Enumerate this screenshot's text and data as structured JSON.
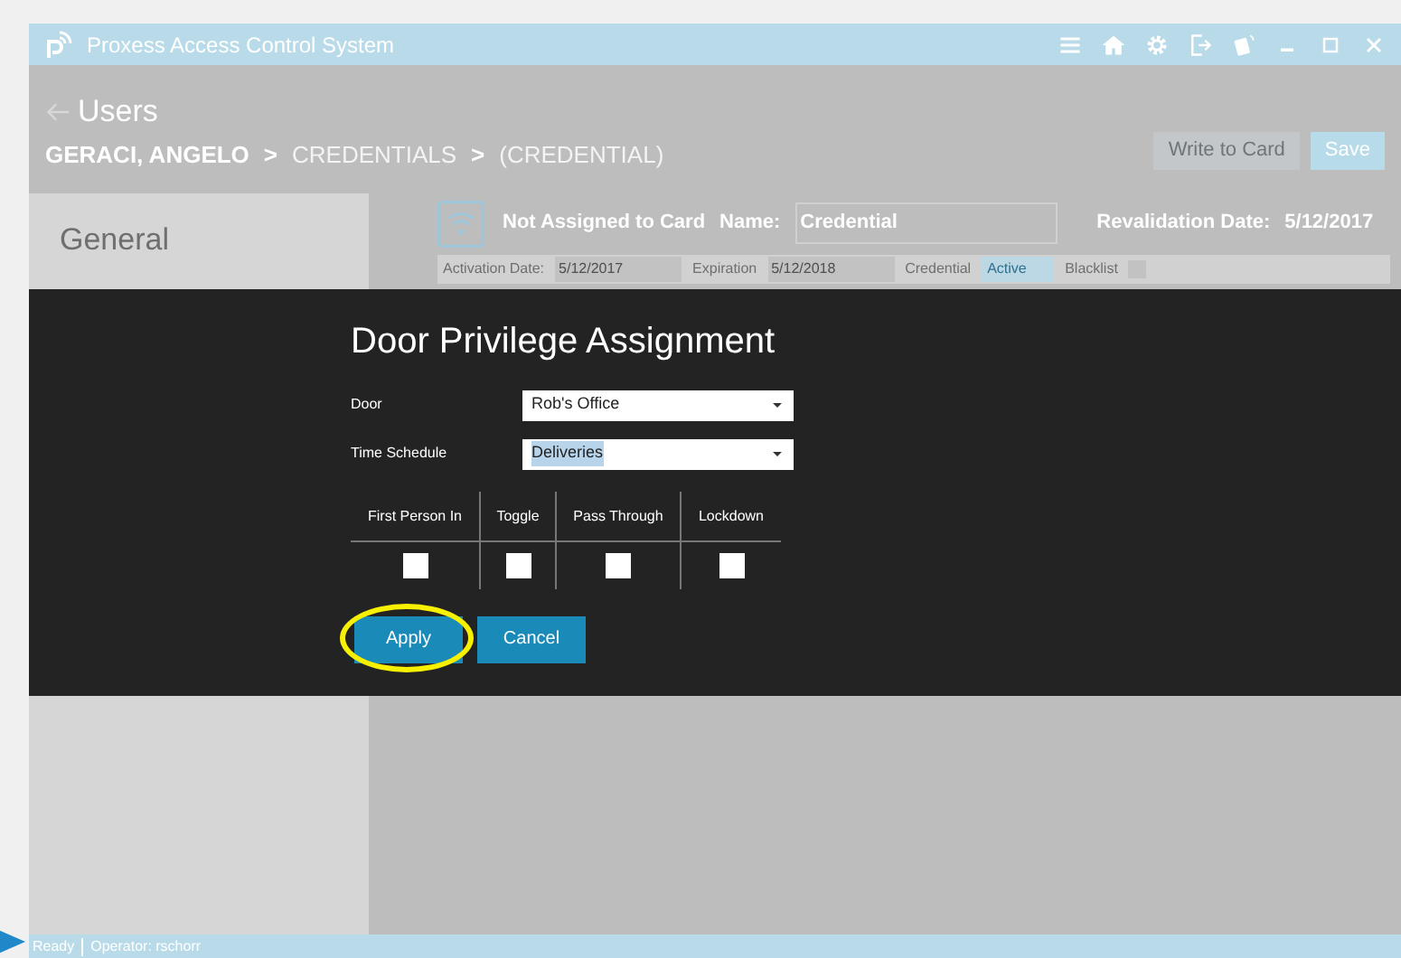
{
  "window": {
    "title": "Proxess Access Control System"
  },
  "header": {
    "back_label": "Users",
    "breadcrumb": [
      {
        "text": "GERACI, ANGELO",
        "current": true
      },
      {
        "text": ">",
        "current": true
      },
      {
        "text": "CREDENTIALS",
        "current": false
      },
      {
        "text": ">",
        "current": true
      },
      {
        "text": "(CREDENTIAL)",
        "current": false
      }
    ],
    "buttons": [
      {
        "label": "Write to Card",
        "disabled": true
      },
      {
        "label": "Save",
        "disabled": false
      }
    ]
  },
  "sidebar": {
    "items": [
      {
        "label": "General",
        "selected": true
      }
    ]
  },
  "credential": {
    "status": "Not Assigned to Card",
    "name_label": "Name:",
    "name_value": "Credential",
    "revalidation_label": "Revalidation Date:",
    "revalidation_value": "5/12/2017",
    "fields": [
      {
        "label": "Activation Date:",
        "value": "5/12/2017",
        "kind": "date"
      },
      {
        "label": "Expiration",
        "value": "5/12/2018",
        "kind": "date"
      },
      {
        "label": "Credential",
        "value": "Active",
        "kind": "select"
      },
      {
        "label": "Blacklist",
        "kind": "checkbox",
        "checked": false
      }
    ]
  },
  "dialog": {
    "title": "Door Privilege Assignment",
    "fields": [
      {
        "label": "Door",
        "value": "Rob's Office",
        "highlighted": false
      },
      {
        "label": "Time Schedule",
        "value": "Deliveries",
        "highlighted": true
      }
    ],
    "options": [
      {
        "label": "First Person In",
        "checked": false
      },
      {
        "label": "Toggle",
        "checked": false
      },
      {
        "label": "Pass Through",
        "checked": false
      },
      {
        "label": "Lockdown",
        "checked": false
      }
    ],
    "buttons": [
      {
        "label": "Apply",
        "circled": true
      },
      {
        "label": "Cancel",
        "circled": false
      }
    ]
  },
  "status_bar": {
    "state": "Ready",
    "operator": "Operator:  rschorr"
  }
}
